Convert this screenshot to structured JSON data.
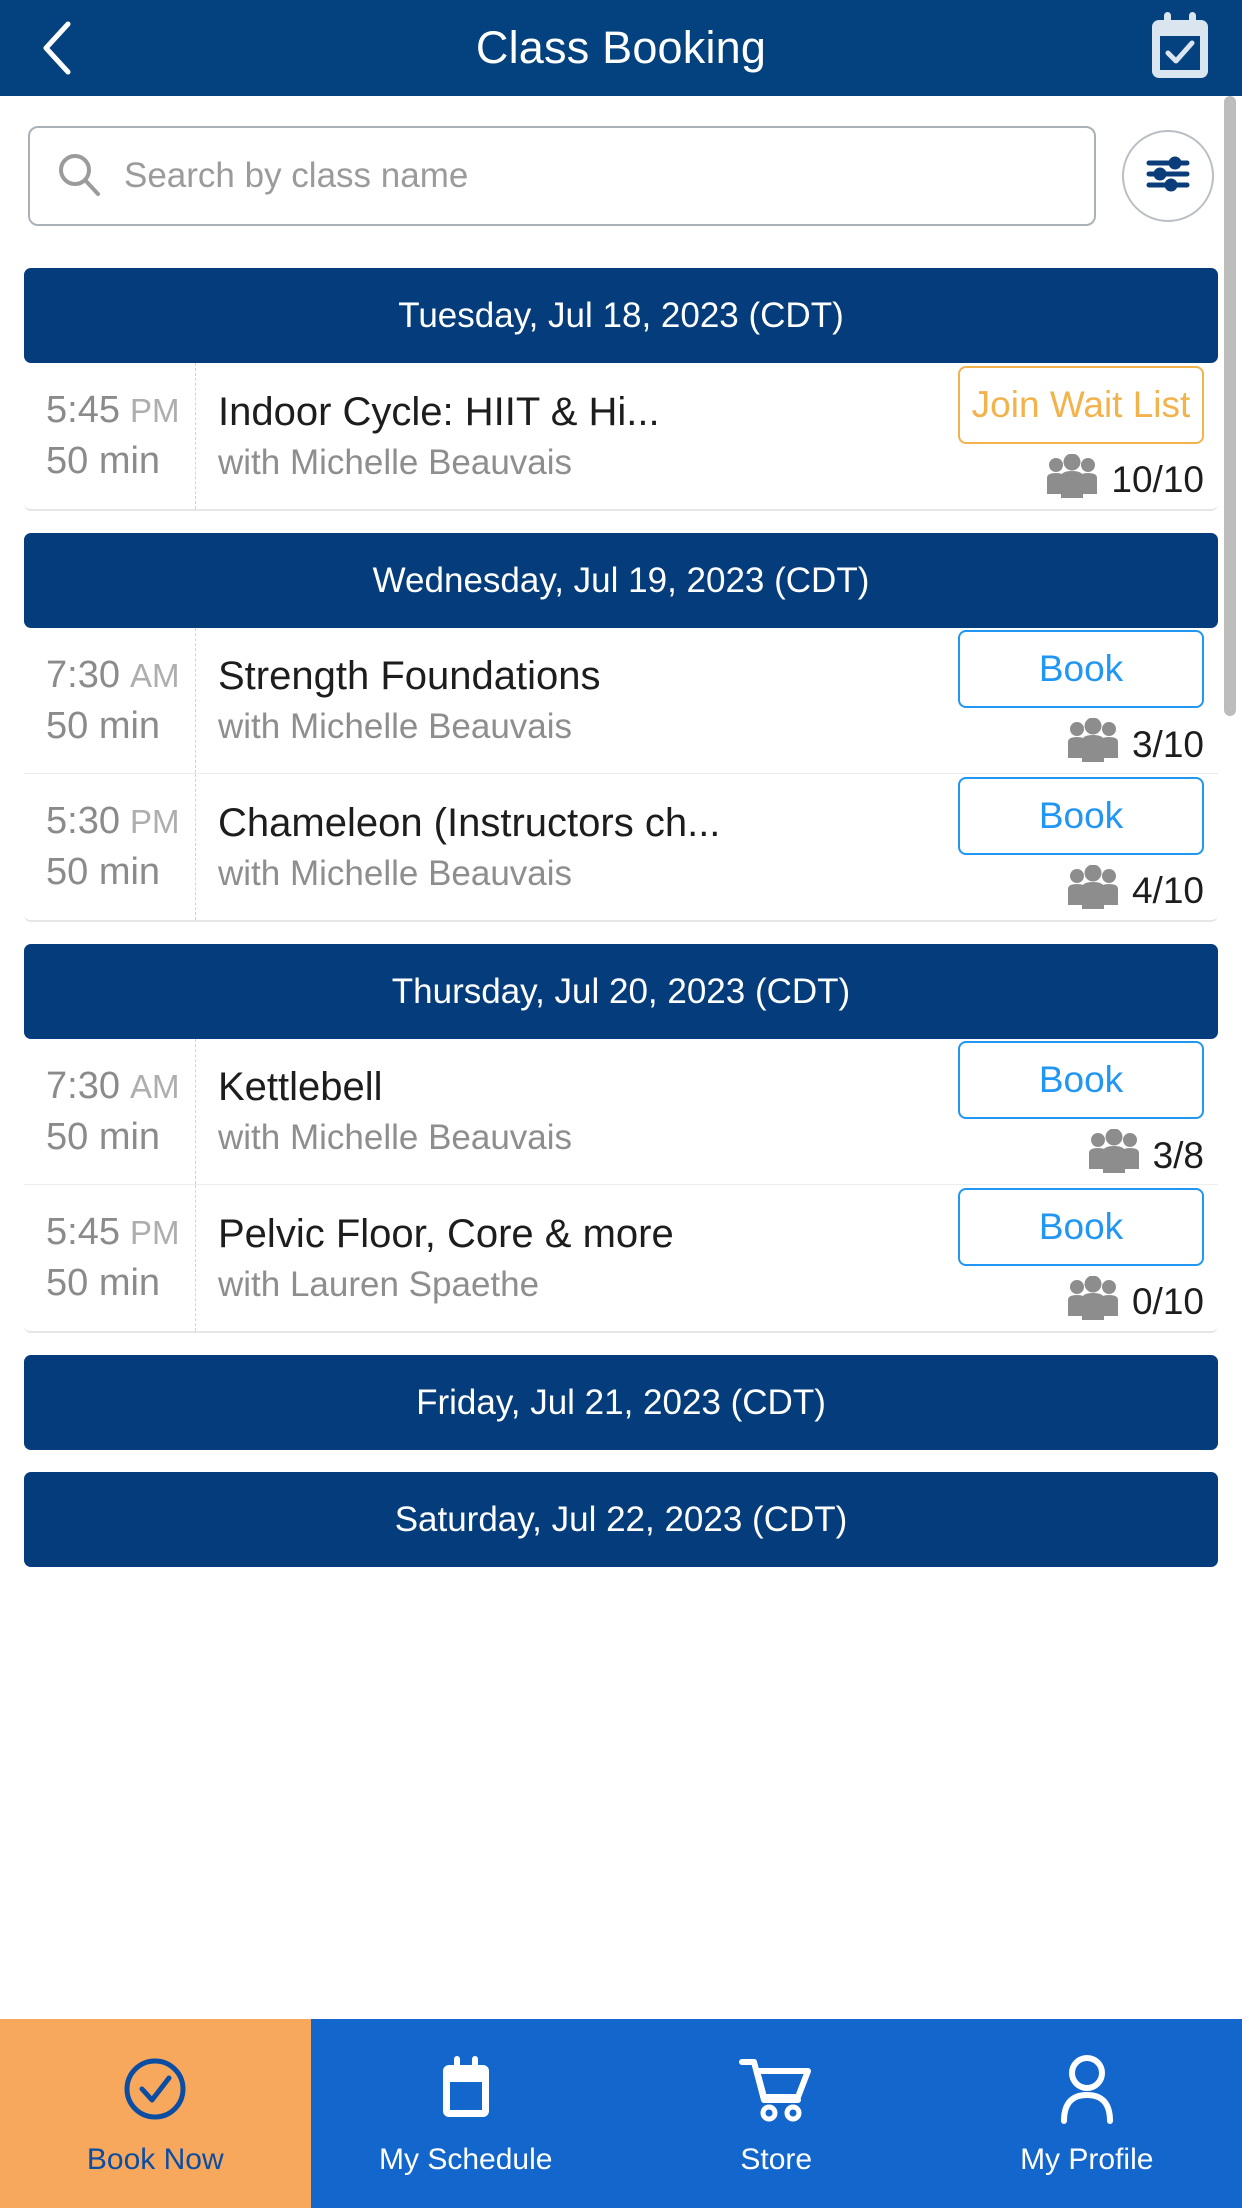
{
  "header": {
    "title": "Class Booking",
    "back_icon": "chevron-left-icon",
    "calendar_icon": "calendar-check-icon"
  },
  "search": {
    "placeholder": "Search by class name",
    "value": "",
    "search_icon": "search-icon",
    "filter_icon": "sliders-filter-icon"
  },
  "colors": {
    "header_navy": "#03427e",
    "day_header_navy": "#053d7c",
    "book_blue": "#2196f3",
    "waitlist_amber": "#f2b24c",
    "nav_blue": "#1266cc",
    "active_orange": "#f7a85c",
    "active_label_blue": "#0b4da2"
  },
  "days": [
    {
      "label": "Tuesday, Jul 18, 2023 (CDT)",
      "classes": [
        {
          "time": "5:45",
          "ampm": "PM",
          "duration": "50 min",
          "name": "Indoor Cycle: HIIT & Hi...",
          "instructor": "with Michelle Beauvais",
          "action_label": "Join Wait List",
          "action_type": "waitlist",
          "capacity": "10/10"
        }
      ]
    },
    {
      "label": "Wednesday, Jul 19, 2023 (CDT)",
      "classes": [
        {
          "time": "7:30",
          "ampm": "AM",
          "duration": "50 min",
          "name": "Strength Foundations",
          "instructor": "with Michelle Beauvais",
          "action_label": "Book",
          "action_type": "book",
          "capacity": "3/10"
        },
        {
          "time": "5:30",
          "ampm": "PM",
          "duration": "50 min",
          "name": "Chameleon (Instructors ch...",
          "instructor": "with Michelle Beauvais",
          "action_label": "Book",
          "action_type": "book",
          "capacity": "4/10"
        }
      ]
    },
    {
      "label": "Thursday, Jul 20, 2023 (CDT)",
      "classes": [
        {
          "time": "7:30",
          "ampm": "AM",
          "duration": "50 min",
          "name": "Kettlebell",
          "instructor": "with Michelle Beauvais",
          "action_label": "Book",
          "action_type": "book",
          "capacity": "3/8"
        },
        {
          "time": "5:45",
          "ampm": "PM",
          "duration": "50 min",
          "name": "Pelvic Floor, Core & more",
          "instructor": "with Lauren Spaethe",
          "action_label": "Book",
          "action_type": "book",
          "capacity": "0/10"
        }
      ]
    },
    {
      "label": "Friday, Jul 21, 2023 (CDT)",
      "classes": []
    },
    {
      "label": "Saturday, Jul 22, 2023 (CDT)",
      "classes": []
    }
  ],
  "bottom_nav": [
    {
      "label": "Book Now",
      "icon": "check-circle-icon",
      "active": true
    },
    {
      "label": "My Schedule",
      "icon": "calendar-icon",
      "active": false
    },
    {
      "label": "Store",
      "icon": "shopping-cart-icon",
      "active": false
    },
    {
      "label": "My Profile",
      "icon": "user-icon",
      "active": false
    }
  ]
}
